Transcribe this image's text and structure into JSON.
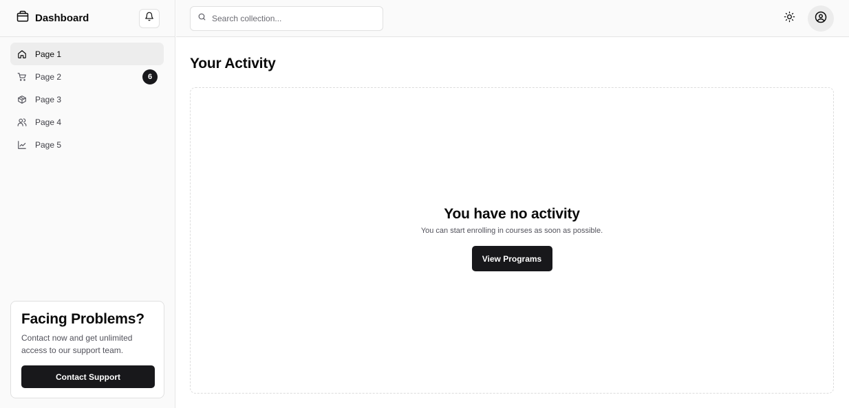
{
  "brand": {
    "title": "Dashboard",
    "icon": "store-icon"
  },
  "sidebar": {
    "items": [
      {
        "label": "Page 1",
        "icon": "home-icon",
        "active": true
      },
      {
        "label": "Page 2",
        "icon": "cart-icon",
        "badge": "6"
      },
      {
        "label": "Page 3",
        "icon": "package-icon"
      },
      {
        "label": "Page 4",
        "icon": "users-icon"
      },
      {
        "label": "Page 5",
        "icon": "line-chart-icon"
      }
    ]
  },
  "support": {
    "title": "Facing Problems?",
    "text": "Contact now and get unlimited access to our support team.",
    "button": "Contact Support"
  },
  "search": {
    "placeholder": "Search collection..."
  },
  "main": {
    "title": "Your Activity",
    "empty_title": "You have no activity",
    "empty_text": "You can start enrolling in courses as soon as possible.",
    "button": "View Programs"
  },
  "colors": {
    "accent": "#18181b",
    "sidebar_bg": "#fafafa",
    "active_bg": "#ededed",
    "border": "#e5e5e5"
  }
}
